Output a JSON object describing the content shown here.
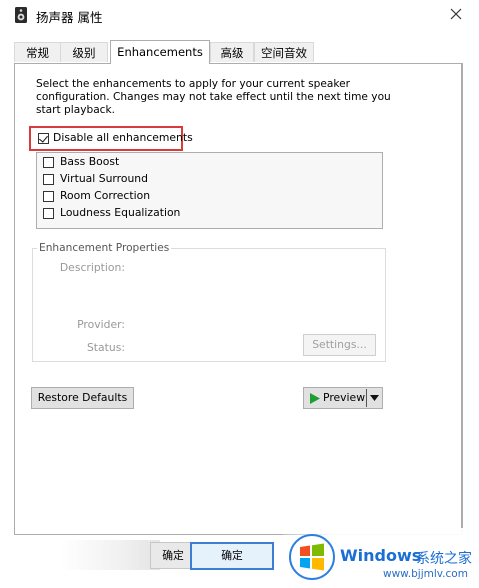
{
  "window": {
    "title": "扬声器 属性",
    "close_label": "✕"
  },
  "tabs": [
    {
      "label": "常规",
      "active": false
    },
    {
      "label": "级别",
      "active": false
    },
    {
      "label": "Enhancements",
      "active": true
    },
    {
      "label": "高级",
      "active": false
    },
    {
      "label": "空间音效",
      "active": false
    }
  ],
  "enhancements": {
    "description": "Select the enhancements to apply for your current speaker configuration. Changes may not take effect until the next time you start playback.",
    "disable_all": {
      "label": "Disable all enhancements",
      "checked": true
    },
    "items": [
      {
        "label": "Bass Boost",
        "checked": false
      },
      {
        "label": "Virtual Surround",
        "checked": false
      },
      {
        "label": "Room Correction",
        "checked": false
      },
      {
        "label": "Loudness Equalization",
        "checked": false
      }
    ]
  },
  "properties": {
    "title": "Enhancement Properties",
    "description_label": "Description:",
    "provider_label": "Provider:",
    "status_label": "Status:",
    "settings_button": "Settings..."
  },
  "actions": {
    "restore_defaults": "Restore Defaults",
    "preview": "Preview",
    "ok_ghost": "确定",
    "ok": "确定"
  },
  "watermark": {
    "brand": "Windows",
    "site_name": "系统之家",
    "url": "www.bjjmlv.com"
  },
  "colors": {
    "highlight_border": "#d93a3a",
    "preview_arrow": "#1e9e32",
    "windows_logo_blue": "#1b6fd4"
  }
}
